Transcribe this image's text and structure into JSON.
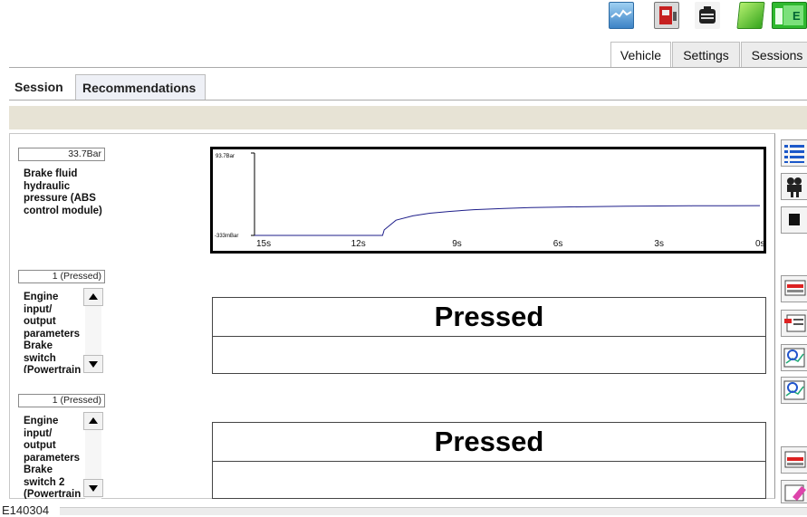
{
  "toolbar": {
    "icons": [
      "graph-icon",
      "vehicle-icon",
      "battery-icon",
      "document-icon",
      "exit-icon"
    ],
    "exit_label": "E"
  },
  "main_tabs": [
    {
      "label": "Vehicle",
      "active": true
    },
    {
      "label": "Settings",
      "active": false
    },
    {
      "label": "Sessions",
      "active": false
    }
  ],
  "sub_tabs": [
    {
      "label": "Session",
      "active": false
    },
    {
      "label": "Recommendations",
      "active": true
    }
  ],
  "signals": [
    {
      "value": "33.7Bar",
      "label": "Brake fluid hydraulic pressure (ABS control module)",
      "graph": {
        "y_max_label": "93.7Bar",
        "y_min_label": "-333mBar",
        "x_ticks": [
          "15s",
          "12s",
          "9s",
          "6s",
          "3s",
          "0s"
        ]
      }
    },
    {
      "value": "1 (Pressed)",
      "label": "Engine input/ output parameters Brake switch (Powertrain",
      "state": "Pressed"
    },
    {
      "value": "1 (Pressed)",
      "label": "Engine input/ output parameters Brake switch 2 (Powertrain",
      "state": "Pressed"
    }
  ],
  "chart_data": {
    "type": "line",
    "title": "",
    "xlabel": "",
    "ylabel": "",
    "x_tick_labels": [
      "15s",
      "12s",
      "9s",
      "6s",
      "3s",
      "0s"
    ],
    "y_tick_labels": [
      "93.7Bar",
      "-333mBar"
    ],
    "ylim": [
      -0.333,
      93.7
    ],
    "x": [
      15,
      13.5,
      12,
      11.2,
      11.15,
      10.8,
      10.3,
      9.8,
      9.2,
      8.5,
      7.6,
      6.8,
      6,
      5,
      4,
      3,
      2,
      1,
      0
    ],
    "series": [
      {
        "values": [
          -0.3,
          -0.3,
          -0.3,
          -0.3,
          6,
          17,
          22,
          25,
          27,
          29,
          30.5,
          31.5,
          32,
          32.5,
          33,
          33.3,
          33.5,
          33.6,
          33.7
        ]
      }
    ],
    "grid": false,
    "colors": {
      "line": "#1e1e8a",
      "frame": "#000000"
    }
  },
  "right_toolbar_icons": [
    "list-icon",
    "camera-icon",
    "stop-icon",
    "record-icon",
    "edit-list-icon",
    "zoom-in-icon",
    "zoom-out-icon",
    "delete-icon",
    "erase-icon"
  ],
  "footer": {
    "figure_id": "E140304"
  }
}
